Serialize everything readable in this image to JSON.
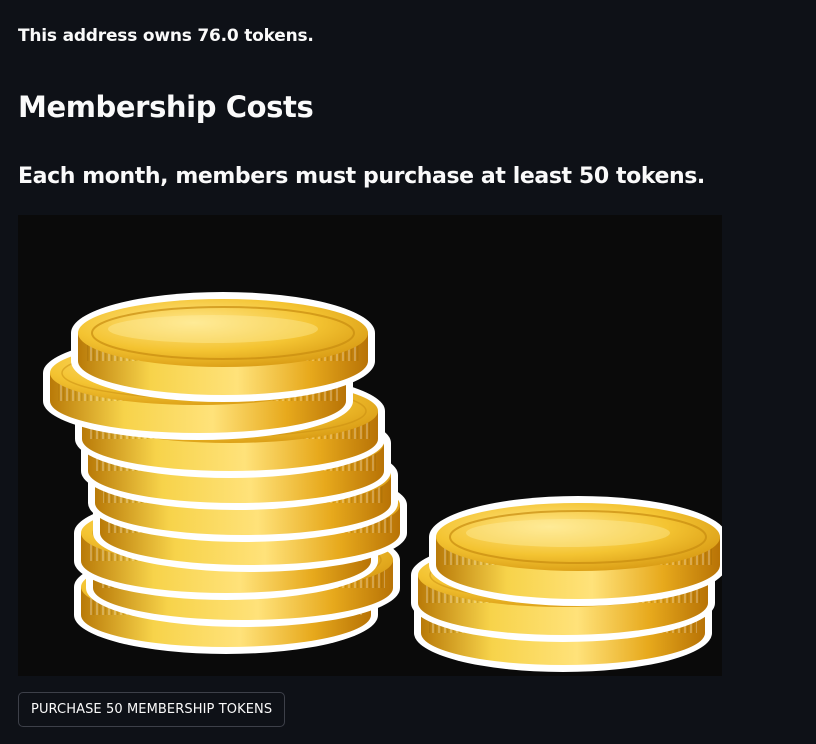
{
  "wallet": {
    "owns_text": "This address owns 76.0 tokens."
  },
  "membership": {
    "title": "Membership Costs",
    "subtitle": "Each month, members must purchase at least 50 tokens.",
    "image_name": "gold-coin-stacks",
    "purchase_button_label": "PURCHASE 50 MEMBERSHIP TOKENS"
  },
  "colors": {
    "background": "#0e1117",
    "text": "#fafafa",
    "image_background": "#0a0a0a",
    "coin_gold": "#f2c12e",
    "coin_dark": "#c98a0c",
    "button_border": "#3d4049"
  }
}
